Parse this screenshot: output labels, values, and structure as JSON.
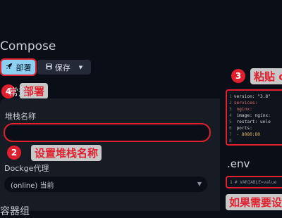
{
  "page": {
    "title": "Compose"
  },
  "toolbar": {
    "deploy_label": "部署",
    "save_label": "保存"
  },
  "general": {
    "heading_partial": "常规",
    "stack_name_label": "堆栈名称",
    "stack_name_value": "",
    "proxy_label": "Dockge代理",
    "proxy_value": "(online) 当前",
    "next_section_partial": "容器组"
  },
  "annotations": {
    "n2": "2",
    "n2_text": "设置堆栈名称",
    "n3": "3",
    "n3_text": "粘贴 c",
    "n4": "4",
    "n4_text": "部署",
    "env_hint": "如果需要设"
  },
  "compose_yaml": {
    "lines": [
      {
        "num": "1",
        "text": "version: \"3.8\""
      },
      {
        "num": "2",
        "text": "services:"
      },
      {
        "num": "3",
        "text": "  nginx:"
      },
      {
        "num": "4",
        "text": "    image: nginx:"
      },
      {
        "num": "5",
        "text": "    restart: unle"
      },
      {
        "num": "6",
        "text": "    ports:"
      },
      {
        "num": "7",
        "text": "      - 8080:80"
      },
      {
        "num": "8",
        "text": ""
      }
    ]
  },
  "env": {
    "title": ".env",
    "line_num": "1",
    "line_text": "# VARIABLE=value"
  },
  "colors": {
    "accent": "#8ed0f2",
    "annotation_red": "#e0202f",
    "background": "#0a0e16",
    "panel": "#161b24"
  }
}
